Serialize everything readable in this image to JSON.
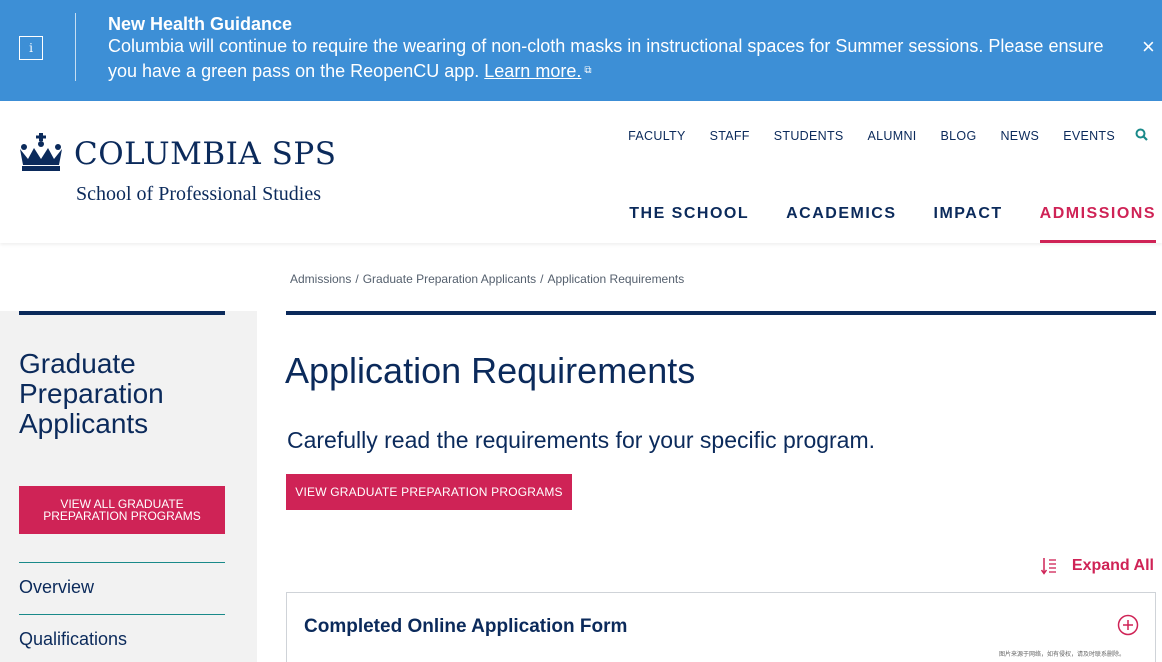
{
  "alert": {
    "icon": "info-icon",
    "title": "New Health Guidance",
    "text": "Columbia will continue to require the wearing of non-cloth masks in instructional spaces for Summer sessions. Please ensure you have a green pass on the ReopenCU app.",
    "link_label": "Learn more.",
    "close_label": "×"
  },
  "header": {
    "logo_main": "COLUMBIA SPS",
    "logo_sub": "School of Professional Studies",
    "utility_nav": [
      "FACULTY",
      "STAFF",
      "STUDENTS",
      "ALUMNI",
      "BLOG",
      "NEWS",
      "EVENTS"
    ],
    "main_nav": [
      "THE SCHOOL",
      "ACADEMICS",
      "IMPACT",
      "ADMISSIONS"
    ],
    "active_nav": "ADMISSIONS"
  },
  "breadcrumb": [
    "Admissions",
    "Graduate Preparation Applicants",
    "Application Requirements"
  ],
  "sidebar": {
    "title": "Graduate Preparation Applicants",
    "button_label": "VIEW ALL GRADUATE PREPARATION PROGRAMS",
    "links": [
      "Overview",
      "Qualifications"
    ]
  },
  "main": {
    "title": "Application Requirements",
    "lead": "Carefully read the requirements for your specific program.",
    "button_label": "VIEW GRADUATE PREPARATION PROGRAMS",
    "expand_all_label": "Expand All",
    "accordion": [
      {
        "title": "Completed Online Application Form"
      }
    ]
  },
  "watermark": "图片来源于网络，如有侵权，请及时联系删除。",
  "colors": {
    "navy": "#0b2a5b",
    "accent": "#cf2356",
    "banner": "#3d8fd6",
    "teal": "#1a8a8a"
  }
}
